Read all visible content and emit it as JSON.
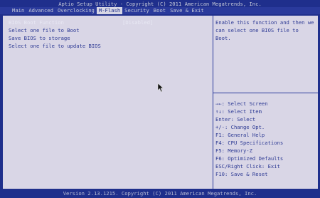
{
  "title": "Aptio Setup Utility - Copyright (C) 2011 American Megatrends, Inc.",
  "tabs": [
    {
      "label": "Main"
    },
    {
      "label": "Advanced"
    },
    {
      "label": "Overclocking"
    },
    {
      "label": "M-Flash"
    },
    {
      "label": "Security"
    },
    {
      "label": "Boot"
    },
    {
      "label": "Save & Exit"
    }
  ],
  "settings": {
    "bios_boot_function": {
      "label": "BIOS Boot Function",
      "value": "[Disabled]"
    },
    "items": [
      {
        "label": "Select one file to Boot"
      },
      {
        "label": "Save BIOS to storage"
      },
      {
        "label": "Select one file to update BIOS"
      }
    ]
  },
  "help": {
    "text": "Enable this function and then we can select one BIOS file to Boot."
  },
  "keys": [
    "→←: Select Screen",
    "↑↓: Select Item",
    "Enter: Select",
    "+/-: Change Opt.",
    "F1: General Help",
    "F4: CPU Specifications",
    "F5: Memory-Z",
    "F6: Optimized Defaults",
    "ESC/Right Click: Exit",
    "F10: Save & Reset"
  ],
  "footer": "Version 2.13.1215. Copyright (C) 2011 American Megatrends, Inc.",
  "colors": {
    "background": "#1f2f8c",
    "panel": "#d9d6e6",
    "text": "#2d3a94",
    "highlight": "#e8e8f4"
  }
}
